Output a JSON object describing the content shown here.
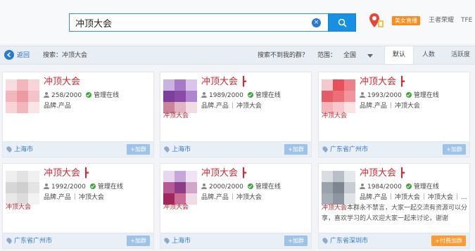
{
  "search": {
    "value": "冲顶大会",
    "clear_icon": "clear-icon",
    "button_icon": "search-icon"
  },
  "top_links": {
    "live": "美女直播",
    "game": "王者荣耀",
    "more": "TFE"
  },
  "filter": {
    "back": "返回",
    "search_label": "搜索：冲顶大会",
    "not_found": "搜索不到我的群？",
    "range_label": "范围：",
    "range_value": "全国",
    "sort_tabs": [
      "默认",
      "人数",
      "活跃度"
    ]
  },
  "cards": [
    {
      "title": "冲顶大会",
      "members": "258/2000",
      "admin": "管理在线",
      "tags": [
        "品牌.产品"
      ],
      "av_label": "",
      "city": "上海市",
      "join": "+加群"
    },
    {
      "title": "冲顶大会 ┣",
      "members": "1989/2000",
      "admin": "管理在线",
      "tags": [
        "品牌.产品",
        "冲顶大会"
      ],
      "av_label": "冲顶大会",
      "city": "上海市",
      "join": "+加群"
    },
    {
      "title": "冲顶大会 ┣",
      "members": "1993/2000",
      "admin": "管理在线",
      "tags": [
        "品牌.产品",
        "冲顶大会"
      ],
      "av_label": "冲顶大会",
      "city": "广东省广州市",
      "join": "+加群"
    },
    {
      "title": "冲顶大会 ┣",
      "members": "1992/2000",
      "admin": "管理在线",
      "tags": [
        "品牌.产品",
        "冲顶大会"
      ],
      "av_label": "冲顶大会",
      "city": "广东省广州市",
      "join": "+加群"
    },
    {
      "title": "冲顶大会 ┣",
      "members": "2000/2000",
      "admin": "管理在线",
      "tags": [
        "品牌.产品",
        "冲顶大会"
      ],
      "av_label": "冲顶大会",
      "city": "上海市",
      "join": "+加群"
    },
    {
      "title": "冲顶大会 ┣",
      "members": "1984/2000",
      "admin": "管理在线",
      "tags": [
        "品牌.产品",
        "冲顶大会",
        "冲顶大会",
        "..."
      ],
      "av_label": "",
      "desc_red": "冲顶大会",
      "desc": "本群永不禁言，大家一起交流有资源可以分享，喜欢学习的人欢迎大家一起来讨论，谢谢",
      "city": "广东省深圳市",
      "join": "+付费加群"
    }
  ],
  "colors": {
    "accent": "#1790e3",
    "title_red": "#d4262e",
    "paid": "#ff9a33"
  }
}
